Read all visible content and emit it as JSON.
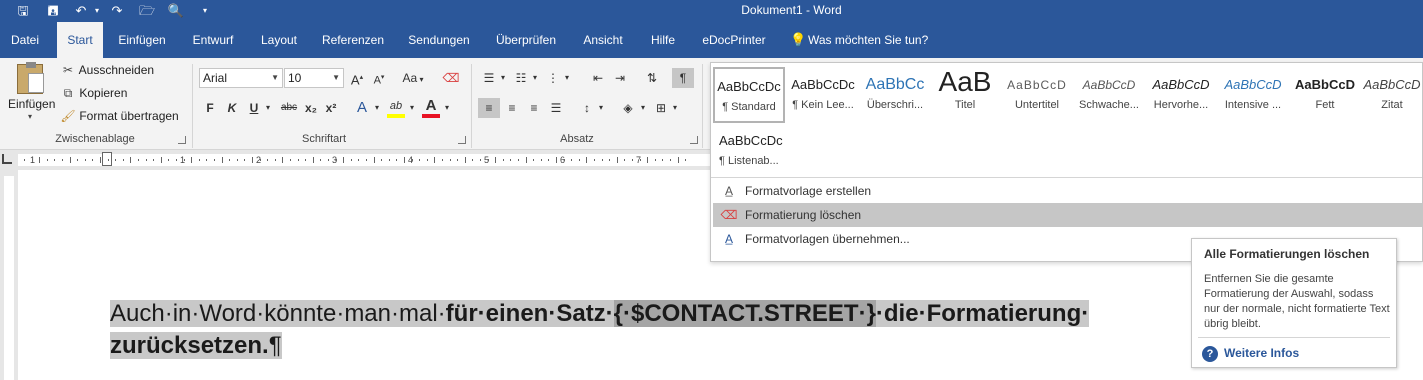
{
  "window": {
    "title": "Dokument1 - Word"
  },
  "quick_access": {
    "save": "🖫",
    "save_as": "🖪",
    "undo": "↶",
    "undo_arrow": "▾",
    "redo": "↷",
    "open": "🗁",
    "preview": "🔍",
    "customize": "▾"
  },
  "tabs": [
    "Datei",
    "Start",
    "Einfügen",
    "Entwurf",
    "Layout",
    "Referenzen",
    "Sendungen",
    "Überprüfen",
    "Ansicht",
    "Hilfe",
    "eDocPrinter"
  ],
  "tell_me": {
    "icon": "lightbulb-icon",
    "text": "Was möchten Sie tun?"
  },
  "clipboard": {
    "paste": "Einfügen",
    "cut": "Ausschneiden",
    "copy": "Kopieren",
    "format_painter": "Format übertragen",
    "group_label": "Zwischenablage"
  },
  "font": {
    "name": "Arial",
    "size": "10",
    "grow": "A",
    "shrink": "A",
    "case": "Aa",
    "bold": "F",
    "italic": "K",
    "underline": "U",
    "strike": "abc",
    "sub": "x₂",
    "sup": "x²",
    "effects": "A",
    "highlight": "ab",
    "color": "A",
    "group_label": "Schriftart"
  },
  "paragraph": {
    "group_label": "Absatz",
    "pilcrow": "¶"
  },
  "styles": [
    {
      "preview": "AaBbCcDc",
      "label": "¶ Standard"
    },
    {
      "preview": "AaBbCcDc",
      "label": "¶ Kein Lee..."
    },
    {
      "preview": "AaBbCc",
      "label": "Überschri..."
    },
    {
      "preview": "AaB",
      "label": "Titel"
    },
    {
      "preview": "AaBbCcD",
      "label": "Untertitel"
    },
    {
      "preview": "AaBbCcD",
      "label": "Schwache..."
    },
    {
      "preview": "AaBbCcD",
      "label": "Hervorhe..."
    },
    {
      "preview": "AaBbCcD",
      "label": "Intensive ..."
    },
    {
      "preview": "AaBbCcD",
      "label": "Fett"
    },
    {
      "preview": "AaBbCcD",
      "label": "Zitat"
    }
  ],
  "styles_row2": [
    {
      "preview": "AaBbCcDc",
      "label": "¶ Listenab..."
    }
  ],
  "style_menu": [
    {
      "label": "Formatvorlage erstellen",
      "icon": "create-style-icon"
    },
    {
      "label": "Formatierung löschen",
      "icon": "clear-formatting-icon"
    },
    {
      "label": "Formatvorlagen übernehmen...",
      "icon": "apply-styles-icon"
    }
  ],
  "ruler": {
    "numbers": [
      "1",
      "1",
      "2",
      "3",
      "4",
      "5",
      "6",
      "7"
    ]
  },
  "document": {
    "text1": "Auch·in·Word·könnte·man·mal·",
    "text2": "für·einen·Satz·",
    "field": "{·$CONTACT.STREET·}",
    "text3": "·die·Formatierung·",
    "text4": "zurücksetzen.",
    "pilcrow": "¶"
  },
  "tooltip": {
    "title": "Alle Formatierungen löschen",
    "body": "Entfernen Sie die gesamte Formatierung der Auswahl, sodass nur der normale, nicht formatierte Text übrig bleibt.",
    "help_icon": "?",
    "more": "Weitere Infos"
  },
  "colors": {
    "brand": "#2b579a",
    "ribbon": "#f3f3f3",
    "selection": "#c8c8c8",
    "highlight_yellow": "#ffff00",
    "font_color_red": "#e81123"
  }
}
